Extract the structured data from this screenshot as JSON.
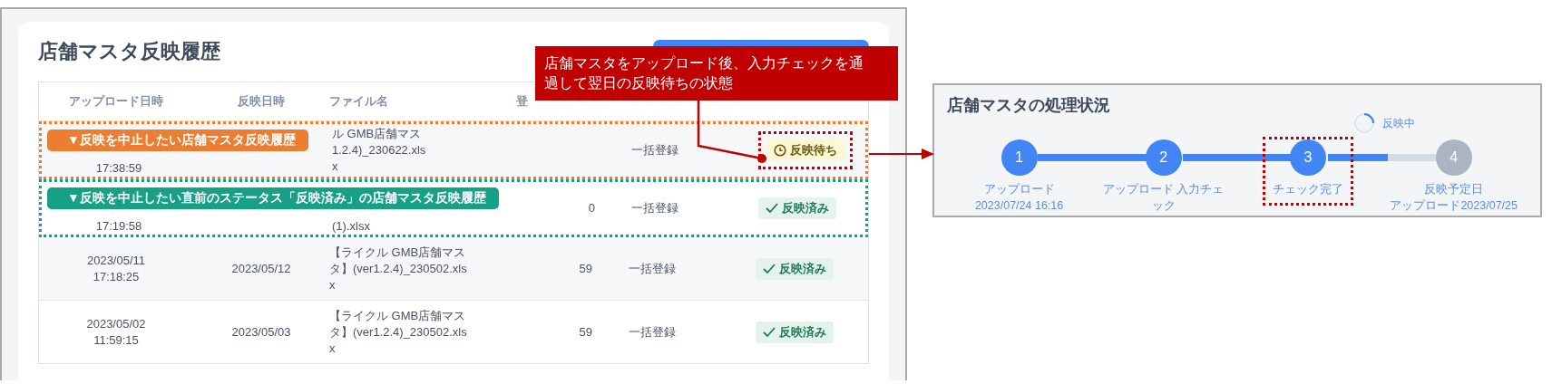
{
  "history": {
    "title": "店舗マスタ反映履歴",
    "callout": {
      "text": "店舗マスタをアップロード後、入力チェックを通過して翌日の反映待ちの状態"
    },
    "table": {
      "columns": [
        "アップロード日時",
        "反映日時",
        "ファイル名",
        "登"
      ],
      "rows": [
        {
          "uploaded": [
            "17:38:59"
          ],
          "file": [
            "ル GMB店舗マス",
            "1.2.4)_230622.xls",
            "x"
          ],
          "method": "一括登録",
          "status": {
            "kind": "waiting",
            "label": "反映待ち",
            "marked": true
          },
          "annotation": {
            "label": "▼反映を中止したい店舗マスタ反映履歴",
            "color": "#ed7d31"
          }
        },
        {
          "uploaded": [
            "17:19:58"
          ],
          "file": [
            "(1).xlsx"
          ],
          "count": "0",
          "method": "一括登録",
          "status": {
            "kind": "done",
            "label": "反映済み",
            "marked": false
          },
          "annotation": {
            "label": "▼反映を中止したい直前のステータス「反映済み」の店舗マスタ反映履歴",
            "color": "#16a085"
          }
        },
        {
          "uploaded": [
            "2023/05/11",
            "17:18:25"
          ],
          "reflected": "2023/05/12",
          "file": [
            "【ライクル GMB店舗マス",
            "タ】(ver1.2.4)_230502.xls",
            "x"
          ],
          "count": "59",
          "method": "一括登録",
          "status": {
            "kind": "done",
            "label": "反映済み",
            "marked": false
          }
        },
        {
          "uploaded": [
            "2023/05/02",
            "11:59:15"
          ],
          "reflected": "2023/05/03",
          "file": [
            "【ライクル GMB店舗マス",
            "タ】(ver1.2.4)_230502.xls",
            "x"
          ],
          "count": "59",
          "method": "一括登録",
          "status": {
            "kind": "done",
            "label": "反映済み",
            "marked": false
          }
        }
      ]
    }
  },
  "status_panel": {
    "title": "店舗マスタの処理状況",
    "progress": {
      "label": "反映中"
    },
    "connectors": [
      {
        "level": 1
      },
      {
        "level": 1
      },
      {
        "level": 0.55
      }
    ],
    "steps": [
      {
        "number": "1",
        "done": true,
        "marked": false,
        "lines": [
          "アップロード",
          "2023/07/24 16:16"
        ]
      },
      {
        "number": "2",
        "done": true,
        "marked": false,
        "lines": [
          "アップロード 入力チェック"
        ]
      },
      {
        "number": "3",
        "done": true,
        "marked": true,
        "lines": [
          "チェック完了"
        ]
      },
      {
        "number": "4",
        "done": false,
        "marked": false,
        "lines": [
          "反映予定日",
          "アップロード2023/07/25"
        ]
      }
    ]
  }
}
